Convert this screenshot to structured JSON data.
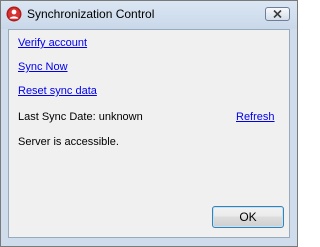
{
  "window": {
    "title": "Synchronization Control",
    "app_icon": "sync-app-icon",
    "close_icon": "close-icon"
  },
  "links": {
    "verify_account": "Verify account",
    "sync_now": "Sync Now",
    "reset_sync_data": "Reset sync data",
    "refresh": "Refresh"
  },
  "status": {
    "last_sync_date": "Last Sync Date: unknown",
    "server_status": "Server is accessible."
  },
  "buttons": {
    "ok_label": "OK"
  },
  "colors": {
    "link": "#0000ee",
    "client_background": "#f0f0f0",
    "frame": "#cfdcec"
  }
}
